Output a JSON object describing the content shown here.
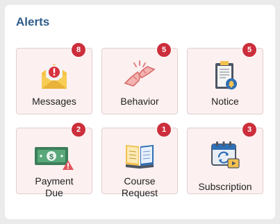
{
  "alerts": {
    "title": "Alerts",
    "tiles": [
      {
        "label": "Messages",
        "count": "8",
        "icon": "envelope-alert-icon"
      },
      {
        "label": "Behavior",
        "count": "5",
        "icon": "fist-bump-icon"
      },
      {
        "label": "Notice",
        "count": "5",
        "icon": "clipboard-bell-icon"
      },
      {
        "label": "Payment\nDue",
        "count": "2",
        "icon": "banknote-warning-icon"
      },
      {
        "label": "Course\nRequest",
        "count": "1",
        "icon": "open-book-icon"
      },
      {
        "label": "Subscription",
        "count": "3",
        "icon": "calendar-renew-icon"
      }
    ]
  },
  "colors": {
    "title": "#2f5c8a",
    "tile_bg": "#fcf0f0",
    "badge": "#cc2e3b"
  }
}
